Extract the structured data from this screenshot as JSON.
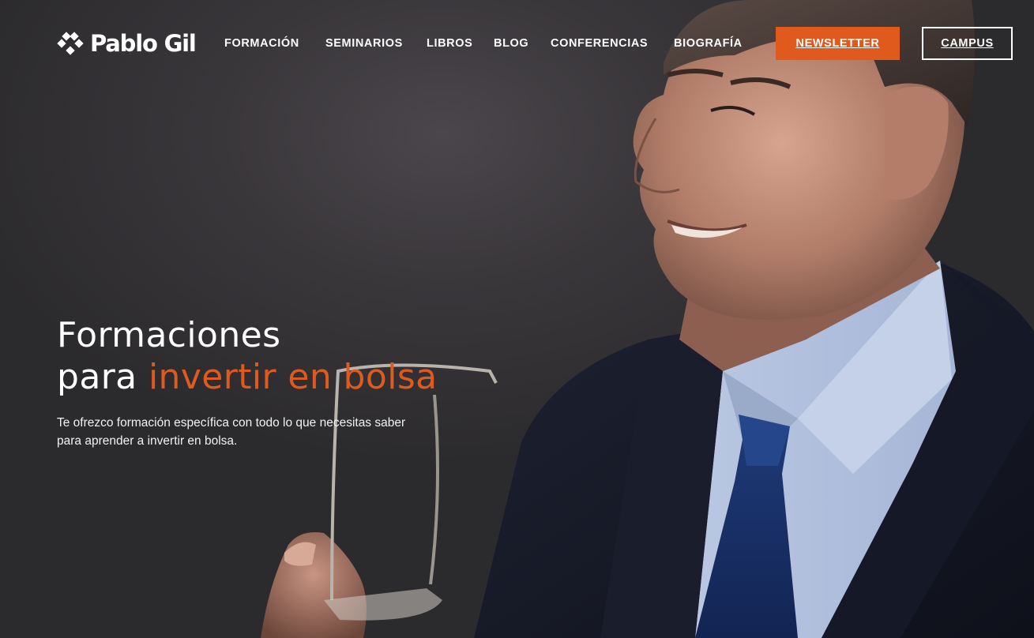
{
  "brand": {
    "name": "Pablo Gil",
    "logo_icon": "diamond-grid-icon"
  },
  "nav": {
    "items": [
      {
        "label": "FORMACIÓN"
      },
      {
        "label": "SEMINARIOS"
      },
      {
        "label": "LIBROS"
      },
      {
        "label": "BLOG"
      },
      {
        "label": "CONFERENCIAS"
      },
      {
        "label": "BIOGRAFÍA"
      }
    ],
    "newsletter_label": "NEWSLETTER",
    "campus_label": "CAMPUS"
  },
  "hero": {
    "headline_line1": "Formaciones",
    "headline_line2_prefix": "para ",
    "headline_line2_accent": "invertir en bolsa",
    "subtitle_line1": "Te ofrezco formación específica con todo lo que necesitas saber",
    "subtitle_line2": "para aprender a invertir en bolsa."
  },
  "colors": {
    "accent": "#e05a1e",
    "background": "#2b2a2b",
    "text": "#ffffff"
  }
}
